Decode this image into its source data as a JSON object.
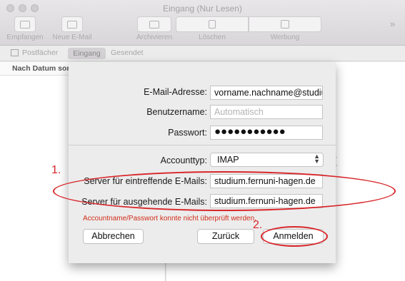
{
  "window": {
    "title": "Eingang (Nur Lesen)"
  },
  "toolbar": {
    "receive_label": "Empfangen",
    "compose_label": "Neue E-Mail",
    "archive_label": "Archivieren",
    "delete_label": "Löschen",
    "junk_label": "Werbung",
    "overflow": "»"
  },
  "favorites": {
    "mailboxes": "Postfächer",
    "inbox": "Eingang",
    "sent": "Gesendet"
  },
  "list": {
    "sort_label": "Nach Datum sor"
  },
  "background": {
    "ghost_text": "nt"
  },
  "dialog": {
    "email_label": "E-Mail-Adresse:",
    "email_value": "vorname.nachname@studiu",
    "username_label": "Benutzername:",
    "username_placeholder": "Automatisch",
    "password_label": "Passwort:",
    "password_value": "●●●●●●●●●●●",
    "account_type_label": "Accounttyp:",
    "account_type_value": "IMAP",
    "incoming_label": "Server für eintreffende E-Mails:",
    "incoming_value": "studium.fernuni-hagen.de",
    "outgoing_label": "Server für ausgehende E-Mails:",
    "outgoing_value": "studium.fernuni-hagen.de",
    "error": "Accountname/Passwort konnte nicht überprüft werden.",
    "cancel_label": "Abbrechen",
    "back_label": "Zurück",
    "signin_label": "Anmelden"
  },
  "annotations": {
    "one": "1.",
    "two": "2.",
    "color": "#d8262a"
  }
}
